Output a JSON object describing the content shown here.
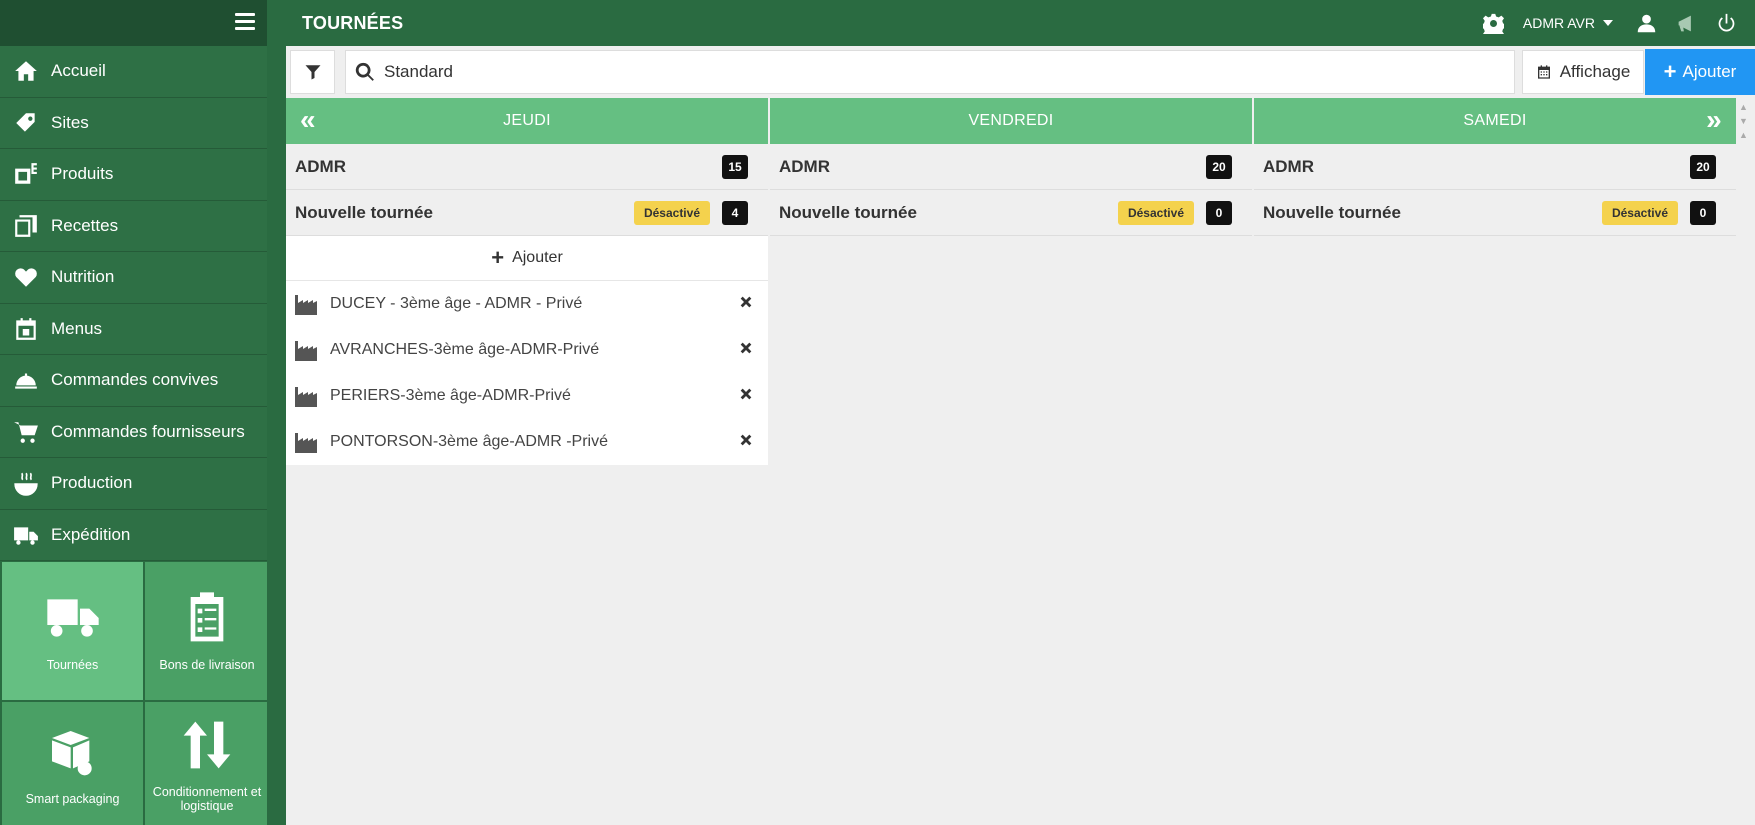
{
  "page": {
    "title": "TOURNÉES"
  },
  "header": {
    "user_name": "ADMR AVR"
  },
  "sidebar": {
    "items": [
      {
        "label": "Accueil",
        "icon": "home-icon"
      },
      {
        "label": "Sites",
        "icon": "tag-icon"
      },
      {
        "label": "Produits",
        "icon": "product-icon"
      },
      {
        "label": "Recettes",
        "icon": "recipe-icon"
      },
      {
        "label": "Nutrition",
        "icon": "heart-icon"
      },
      {
        "label": "Menus",
        "icon": "calendar-icon"
      },
      {
        "label": "Commandes convives",
        "icon": "cloche-icon"
      },
      {
        "label": "Commandes fournisseurs",
        "icon": "cart-icon"
      },
      {
        "label": "Production",
        "icon": "cooking-icon"
      },
      {
        "label": "Expédition",
        "icon": "truck-box-icon"
      }
    ],
    "tiles": [
      {
        "label": "Tournées",
        "icon": "truck-icon"
      },
      {
        "label": "Bons de livraison",
        "icon": "clipboard-icon"
      },
      {
        "label": "Smart packaging",
        "icon": "packaging-icon"
      },
      {
        "label": "Conditionnement et logistique",
        "icon": "arrows-updown-icon"
      }
    ]
  },
  "toolbar": {
    "search_value": "Standard",
    "affichage_label": "Affichage",
    "add_label": "Ajouter"
  },
  "columns": [
    {
      "day": "JEUDI",
      "group": {
        "name": "ADMR",
        "count": "15"
      },
      "tour": {
        "name": "Nouvelle tournée",
        "status": "Désactivé",
        "count": "4"
      },
      "add_label": "Ajouter",
      "sites": [
        "DUCEY - 3ème âge - ADMR - Privé",
        "AVRANCHES-3ème âge-ADMR-Privé",
        "PERIERS-3ème âge-ADMR-Privé",
        "PONTORSON-3ème âge-ADMR -Privé"
      ]
    },
    {
      "day": "VENDREDI",
      "group": {
        "name": "ADMR",
        "count": "20"
      },
      "tour": {
        "name": "Nouvelle tournée",
        "status": "Désactivé",
        "count": "0"
      }
    },
    {
      "day": "SAMEDI",
      "group": {
        "name": "ADMR",
        "count": "20"
      },
      "tour": {
        "name": "Nouvelle tournée",
        "status": "Désactivé",
        "count": "0"
      }
    }
  ],
  "colors": {
    "sidebar": "#2a6b41",
    "header": "#65bf82",
    "accent": "#2196f3",
    "badge_warning": "#f4d24d"
  }
}
